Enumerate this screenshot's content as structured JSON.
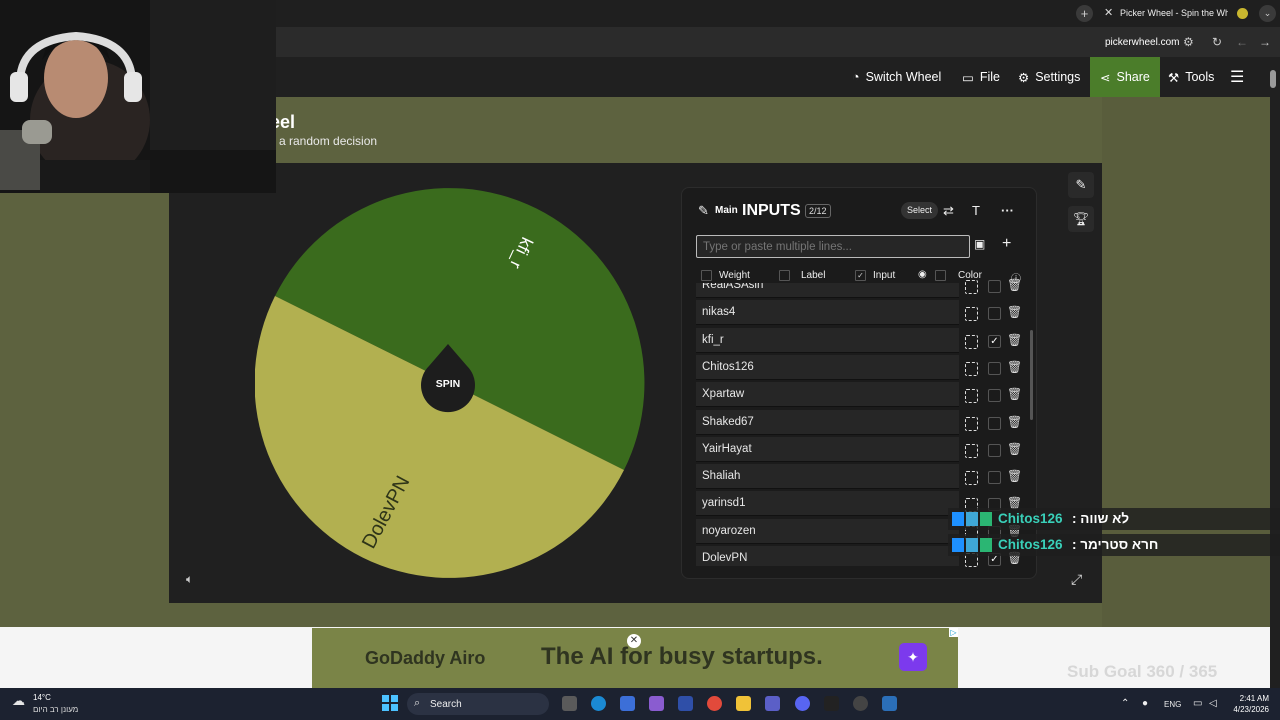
{
  "browser": {
    "tab_title": "Picker Wheel - Spin the Wheel",
    "tab_close": "✕",
    "new_tab": "+",
    "url": "pickerwheel.com"
  },
  "nav": {
    "switch_wheel": "Switch Wheel",
    "file": "File",
    "settings": "Settings",
    "share": "Share",
    "tools": "Tools"
  },
  "page": {
    "title": "eel",
    "subtitle": "a random decision"
  },
  "wheel": {
    "spin_label": "SPIN",
    "segments": [
      {
        "label": "kfi_r",
        "color": "#3a6b1d"
      },
      {
        "label": "DolevPN",
        "color": "#b2b050"
      }
    ]
  },
  "inputs": {
    "mode_badge": "Main",
    "title": "INPUTS",
    "count": "2/12",
    "select_label": "Select",
    "placeholder": "Type or paste multiple lines...",
    "columns": {
      "weight": "Weight",
      "label": "Label",
      "input": "Input",
      "color": "Color"
    },
    "items": [
      {
        "name": "RealASAsin",
        "checked": false
      },
      {
        "name": "nikas4",
        "checked": false
      },
      {
        "name": "kfi_r",
        "checked": true
      },
      {
        "name": "Chitos126",
        "checked": false
      },
      {
        "name": "Xpartaw",
        "checked": false
      },
      {
        "name": "Shaked67",
        "checked": false
      },
      {
        "name": "YairHayat",
        "checked": false
      },
      {
        "name": "Shaliah",
        "checked": false
      },
      {
        "name": "yarinsd1",
        "checked": false
      },
      {
        "name": "noyarozen",
        "checked": false
      },
      {
        "name": "DolevPN",
        "checked": true
      }
    ]
  },
  "chat": [
    {
      "user": "Chitos126",
      "message": ": לא שווה"
    },
    {
      "user": "Chitos126",
      "message": ": חרא סטרימר"
    }
  ],
  "ad": {
    "logo": "GoDaddy Airo",
    "text": "The AI for busy startups."
  },
  "stream": {
    "sub_goal": "Sub Goal 360 / 365"
  },
  "taskbar": {
    "temperature": "14°C",
    "weather_desc": "מעונן רב היום",
    "search_label": "Search",
    "language": "ENG",
    "time": "2:41 AM",
    "date": "4/23/2026"
  }
}
